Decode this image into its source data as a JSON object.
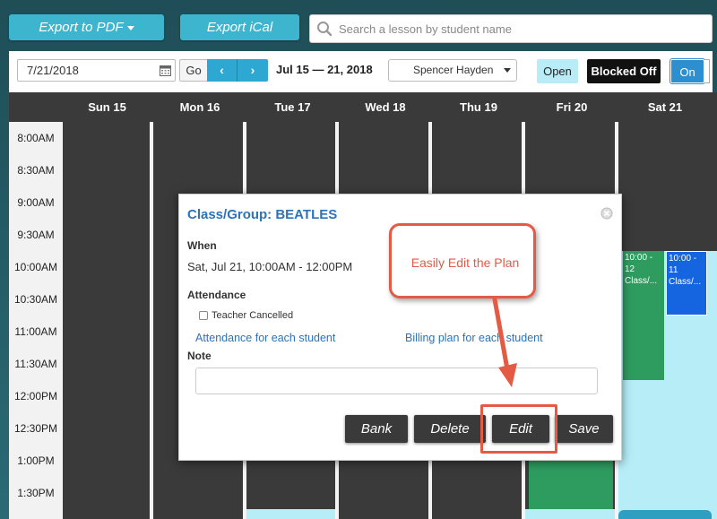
{
  "topbar": {
    "export_pdf_label": "Export to PDF",
    "export_ical_label": "Export iCal",
    "search_placeholder": "Search a lesson by student name"
  },
  "toolbar": {
    "date_value": "7/21/2018",
    "go_label": "Go",
    "prev_label": "‹",
    "next_label": "›",
    "range_label": "Jul 15 — 21, 2018",
    "teacher_selected": "Spencer Hayden",
    "open_label": "Open",
    "blocked_label": "Blocked Off",
    "on_label": "On"
  },
  "calendar": {
    "days": [
      "Sun 15",
      "Mon 16",
      "Tue 17",
      "Wed 18",
      "Thu 19",
      "Fri 20",
      "Sat 21"
    ],
    "times": [
      "8:00AM",
      "8:30AM",
      "9:00AM",
      "9:30AM",
      "10:00AM",
      "10:30AM",
      "11:00AM",
      "11:30AM",
      "12:00PM",
      "12:30PM",
      "1:00PM",
      "1:30PM"
    ],
    "events": {
      "sat_green_time": "10:00 - 12",
      "sat_green_title": "Class/...",
      "sat_blue_time": "10:00 - 11",
      "sat_blue_title": "Class/..."
    },
    "colors": {
      "green": "#2e9c5f",
      "blue": "#1565e0",
      "light": "#b6edf7",
      "dark": "#3a3a3a"
    }
  },
  "modal": {
    "title": "Class/Group: BEATLES",
    "when_label": "When",
    "when_value": "Sat, Jul 21, 10:00AM - 12:00PM",
    "attendance_label": "Attendance",
    "teacher_cancelled_label": "Teacher Cancelled",
    "attendance_link": "Attendance for each student",
    "billing_link": "Billing plan for each student",
    "note_label": "Note",
    "note_value": "",
    "bank_label": "Bank",
    "delete_label": "Delete",
    "edit_label": "Edit",
    "save_label": "Save"
  },
  "callout": {
    "text": "Easily Edit the Plan",
    "color": "#e35a45"
  }
}
